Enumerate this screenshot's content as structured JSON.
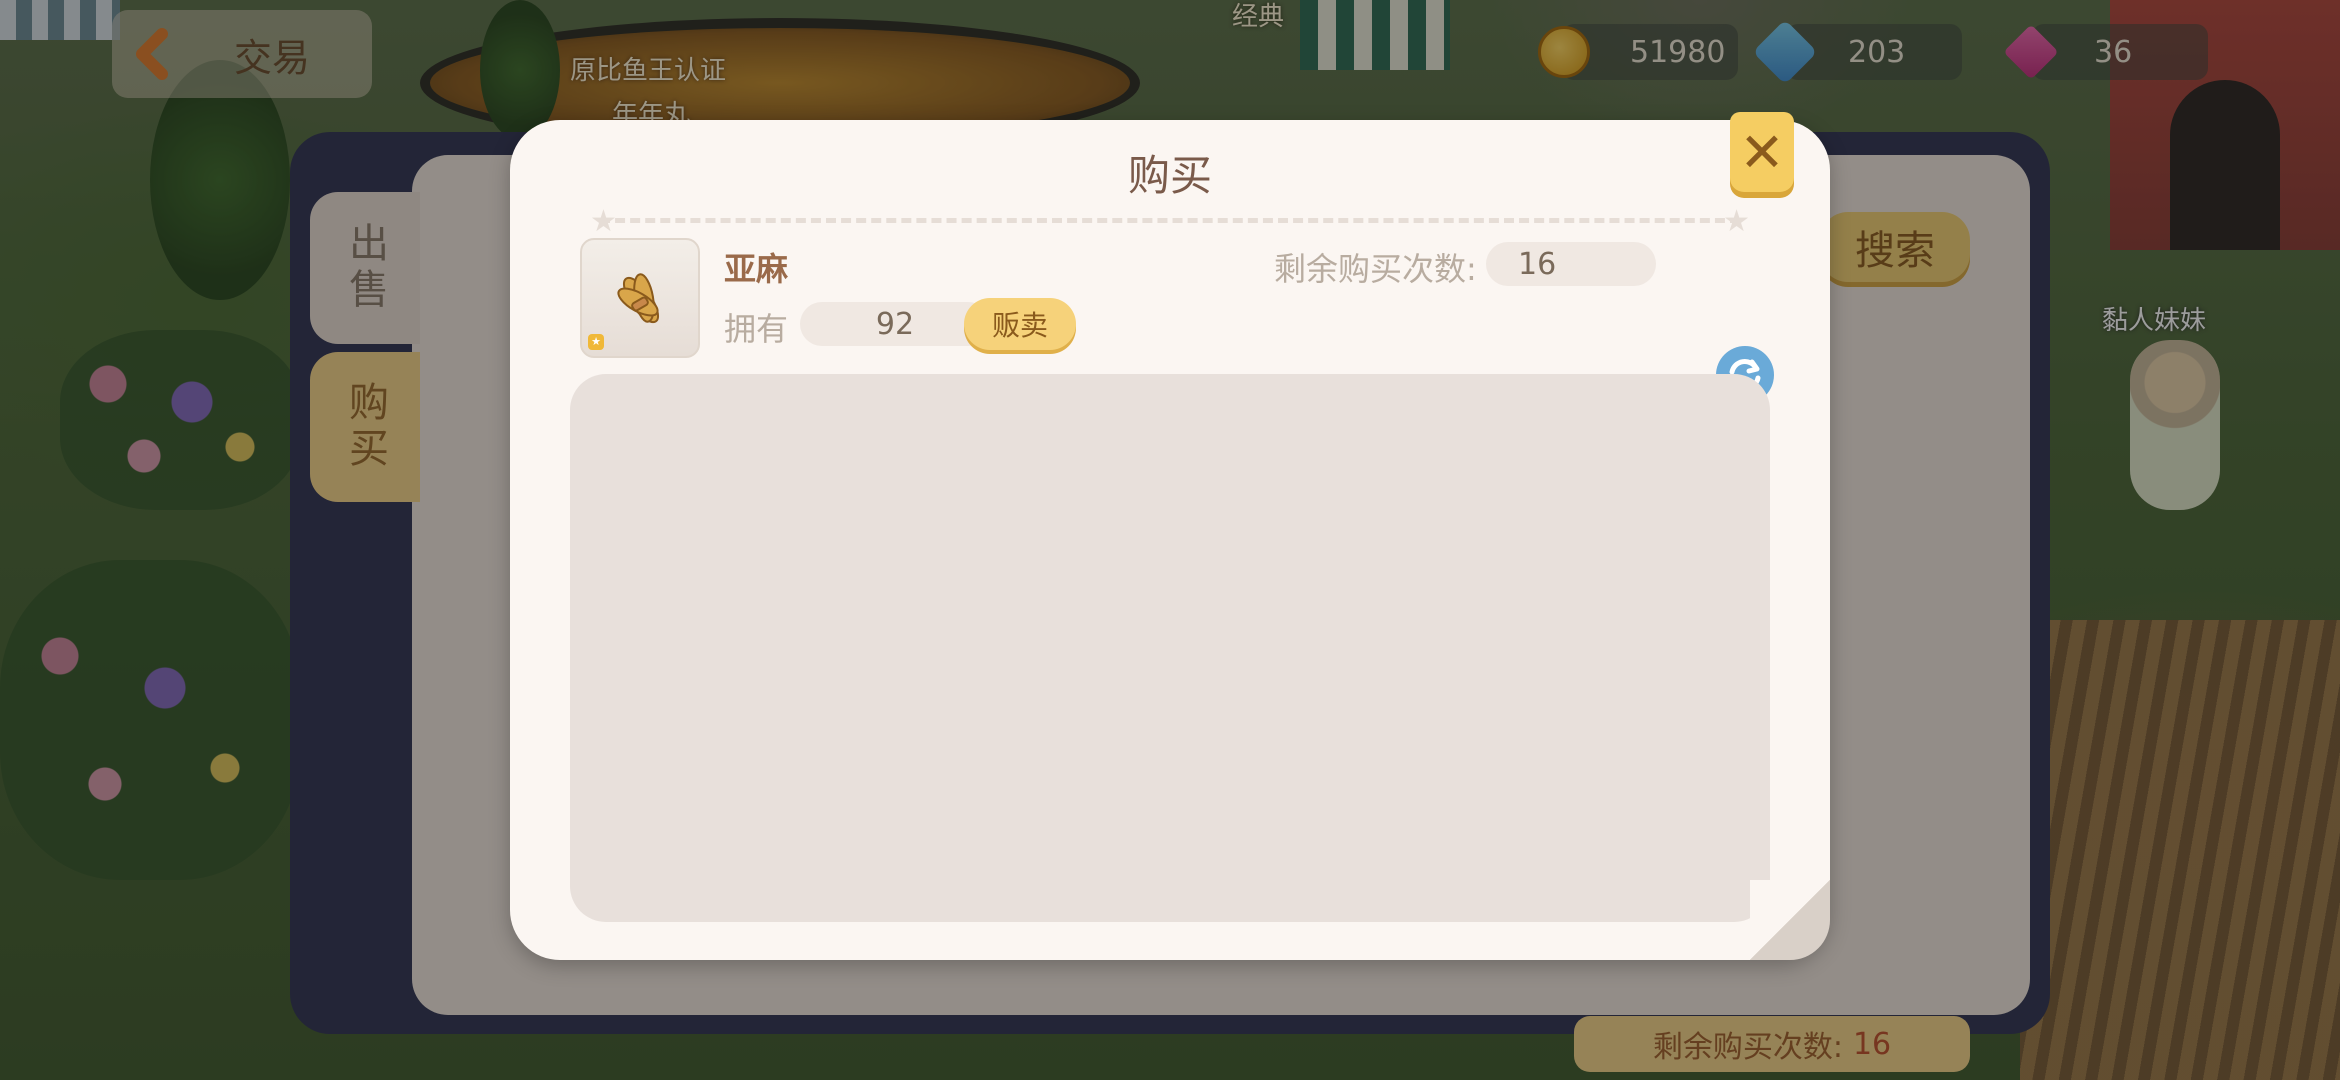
{
  "hud": {
    "back_label": "交易",
    "map_label": "原比鱼王认证",
    "map_sub": "年年丸",
    "npc_top_label": "经典",
    "coins": "51980",
    "gems": "203",
    "diamonds": "36",
    "npc_name": "黏人妹妹"
  },
  "trade_panel": {
    "tab_sell": "出售",
    "tab_buy": "购买",
    "search_label": "搜索",
    "bottom_remaining_label": "剩余购买次数:",
    "bottom_remaining_value": "16"
  },
  "modal": {
    "title": "购买",
    "item_name": "亚麻",
    "own_label": "拥有",
    "own_value": "92",
    "sell_button": "贩卖",
    "remaining_label": "剩余购买次数:",
    "remaining_value": "16",
    "close_icon": "close-icon",
    "refresh_icon": "refresh-icon"
  },
  "colors": {
    "accent": "#f5cd62",
    "panel": "#fbf6f2",
    "frame": "#2f3352"
  }
}
